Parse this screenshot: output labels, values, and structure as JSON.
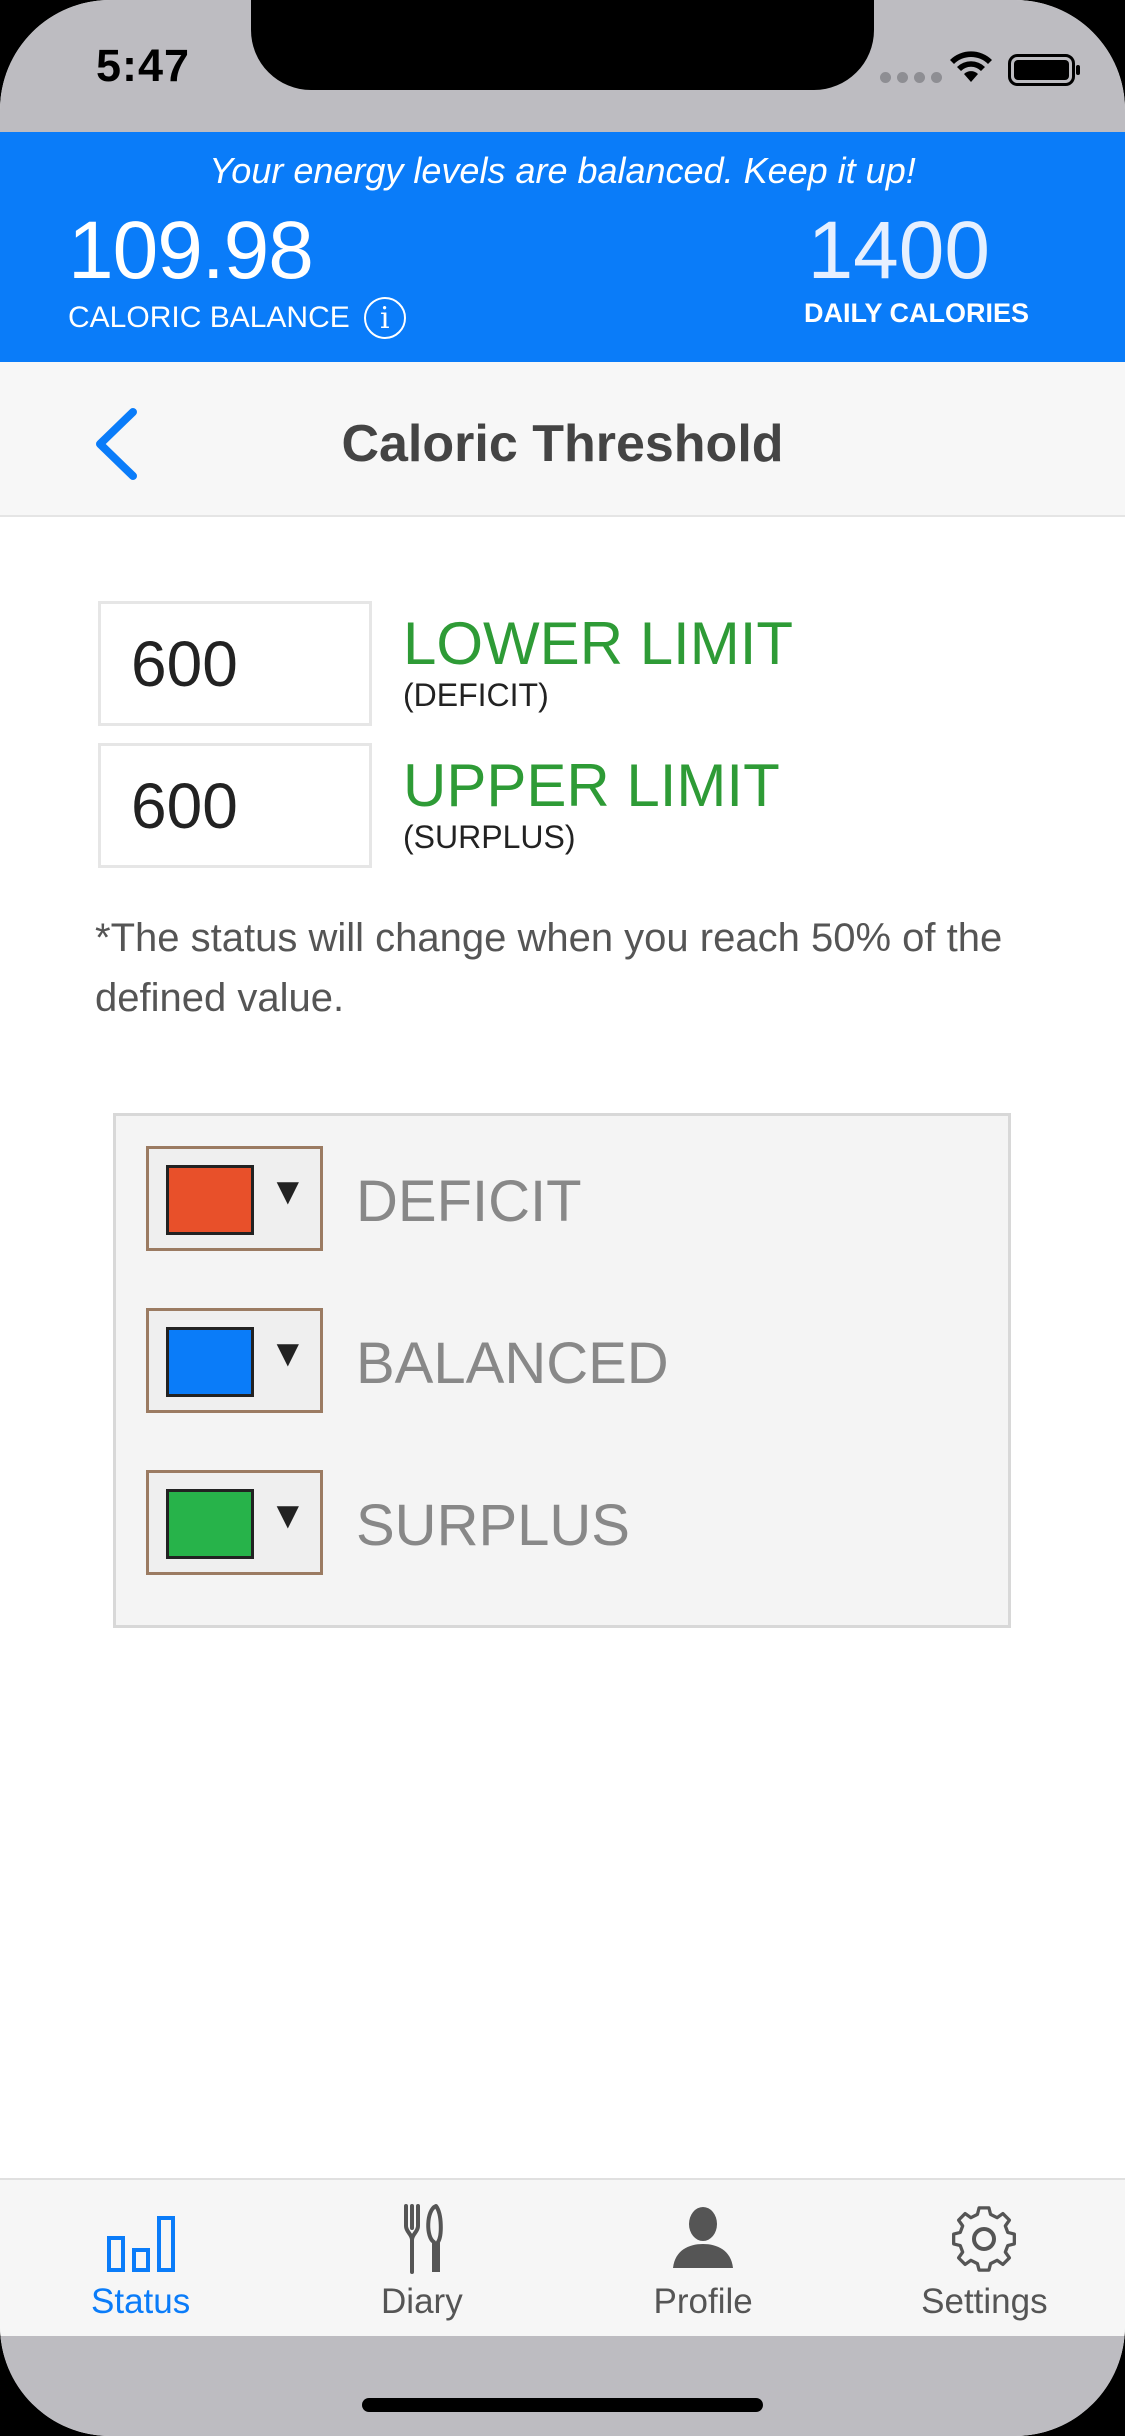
{
  "status_bar": {
    "time": "5:47"
  },
  "energy": {
    "message": "Your energy levels are balanced. Keep it up!",
    "balance_value": "109.98",
    "balance_label": "CALORIC BALANCE",
    "info_glyph": "i",
    "daily_value": "1400",
    "daily_label": "DAILY CALORIES",
    "color": "#0a7cf9"
  },
  "nav": {
    "title": "Caloric Threshold",
    "back_icon": "chevron-left-icon"
  },
  "limits": {
    "lower": {
      "value": "600",
      "title": "LOWER LIMIT",
      "subtitle": "(DEFICIT)"
    },
    "upper": {
      "value": "600",
      "title": "UPPER LIMIT",
      "subtitle": "(SURPLUS)"
    }
  },
  "note": "*The status will change when you reach 50% of the defined value.",
  "colors": [
    {
      "label": "DEFICIT",
      "color": "#e8502a",
      "arrow": "▼"
    },
    {
      "label": "BALANCED",
      "color": "#0a7cf9",
      "arrow": "▼"
    },
    {
      "label": "SURPLUS",
      "color": "#27b34a",
      "arrow": "▼"
    }
  ],
  "tabs": [
    {
      "label": "Status",
      "icon": "bar-chart-icon",
      "active": true
    },
    {
      "label": "Diary",
      "icon": "fork-knife-icon",
      "active": false
    },
    {
      "label": "Profile",
      "icon": "person-icon",
      "active": false
    },
    {
      "label": "Settings",
      "icon": "gear-icon",
      "active": false
    }
  ]
}
